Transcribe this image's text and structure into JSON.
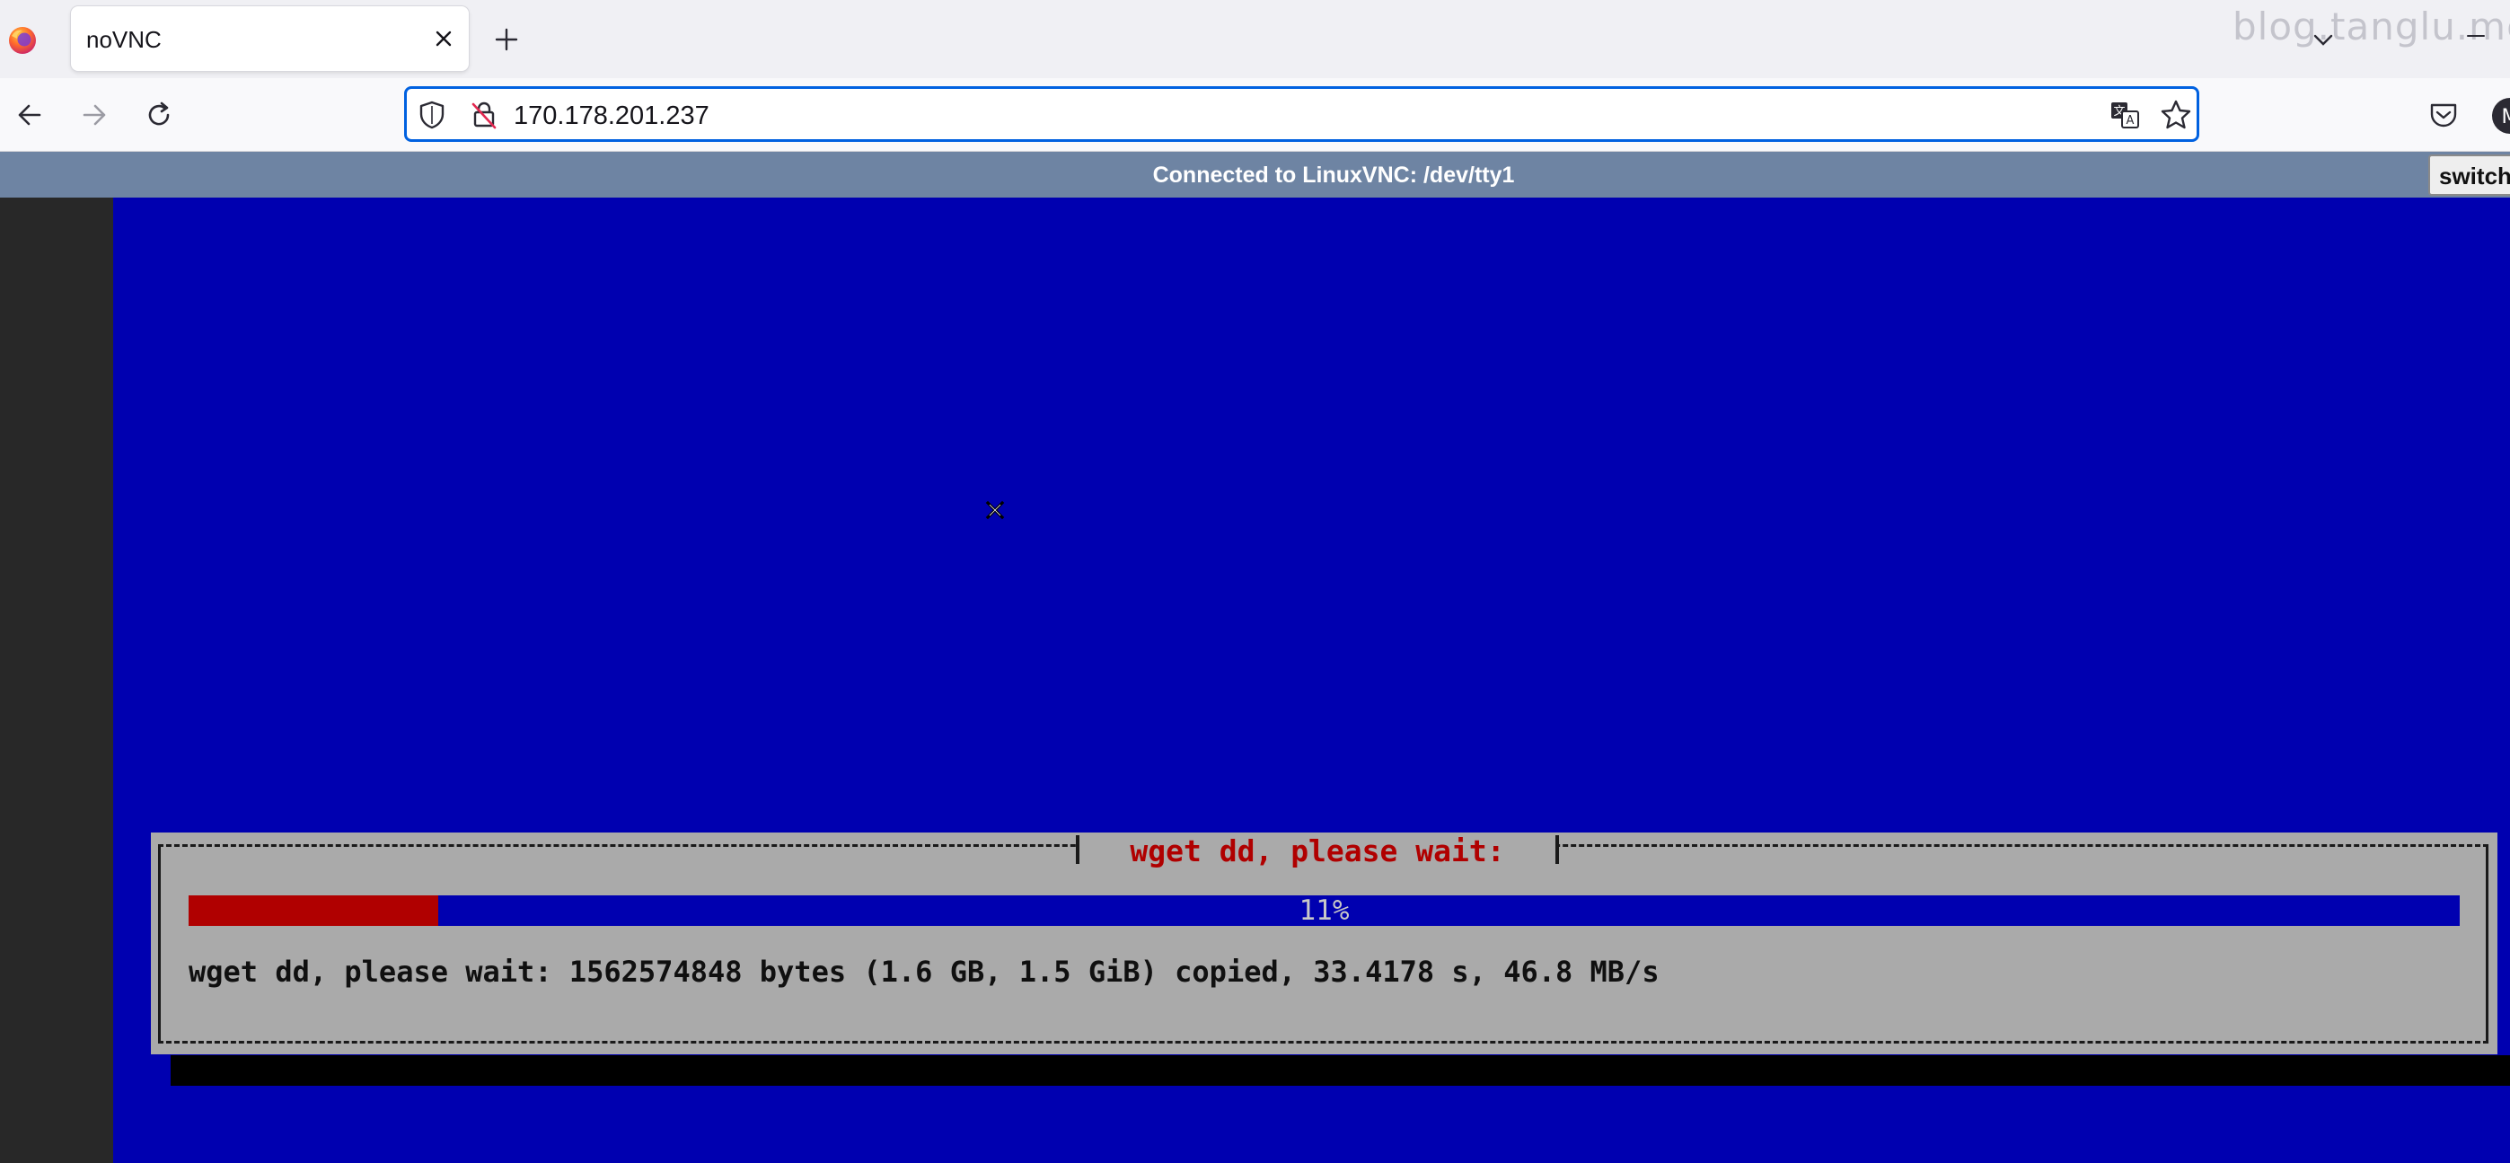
{
  "browser": {
    "tab_title": "noVNC",
    "url": "170.178.201.237",
    "watermark": "blog.tanglu.me"
  },
  "novnc": {
    "status": "Connected to LinuxVNC: /dev/tty1",
    "switch_label": "switch"
  },
  "dialog": {
    "title": " wget dd, please wait: ",
    "progress_percent": 11,
    "progress_label": "11%",
    "message": "wget dd, please wait: 1562574848 bytes (1.6 GB, 1.5 GiB) copied, 33.4178 s, 46.8 MB/s"
  },
  "colors": {
    "console_bg": "#0000b0",
    "dialog_bg": "#aaaaaa",
    "gauge_fill": "#b00000",
    "title_text": "#b00000",
    "novnc_bar": "#6e84a3",
    "url_focus": "#0061e0"
  },
  "icons": {
    "browser_logo": "firefox-logo",
    "tab_close": "close-icon",
    "new_tab": "plus-icon",
    "back": "arrow-left-icon",
    "forward": "arrow-right-icon",
    "reload": "reload-icon",
    "tracking": "shield-icon",
    "insecure": "lock-slash-icon",
    "translate": "translate-icon",
    "bookmark": "star-icon",
    "pocket": "pocket-icon",
    "account": "account-icon"
  }
}
